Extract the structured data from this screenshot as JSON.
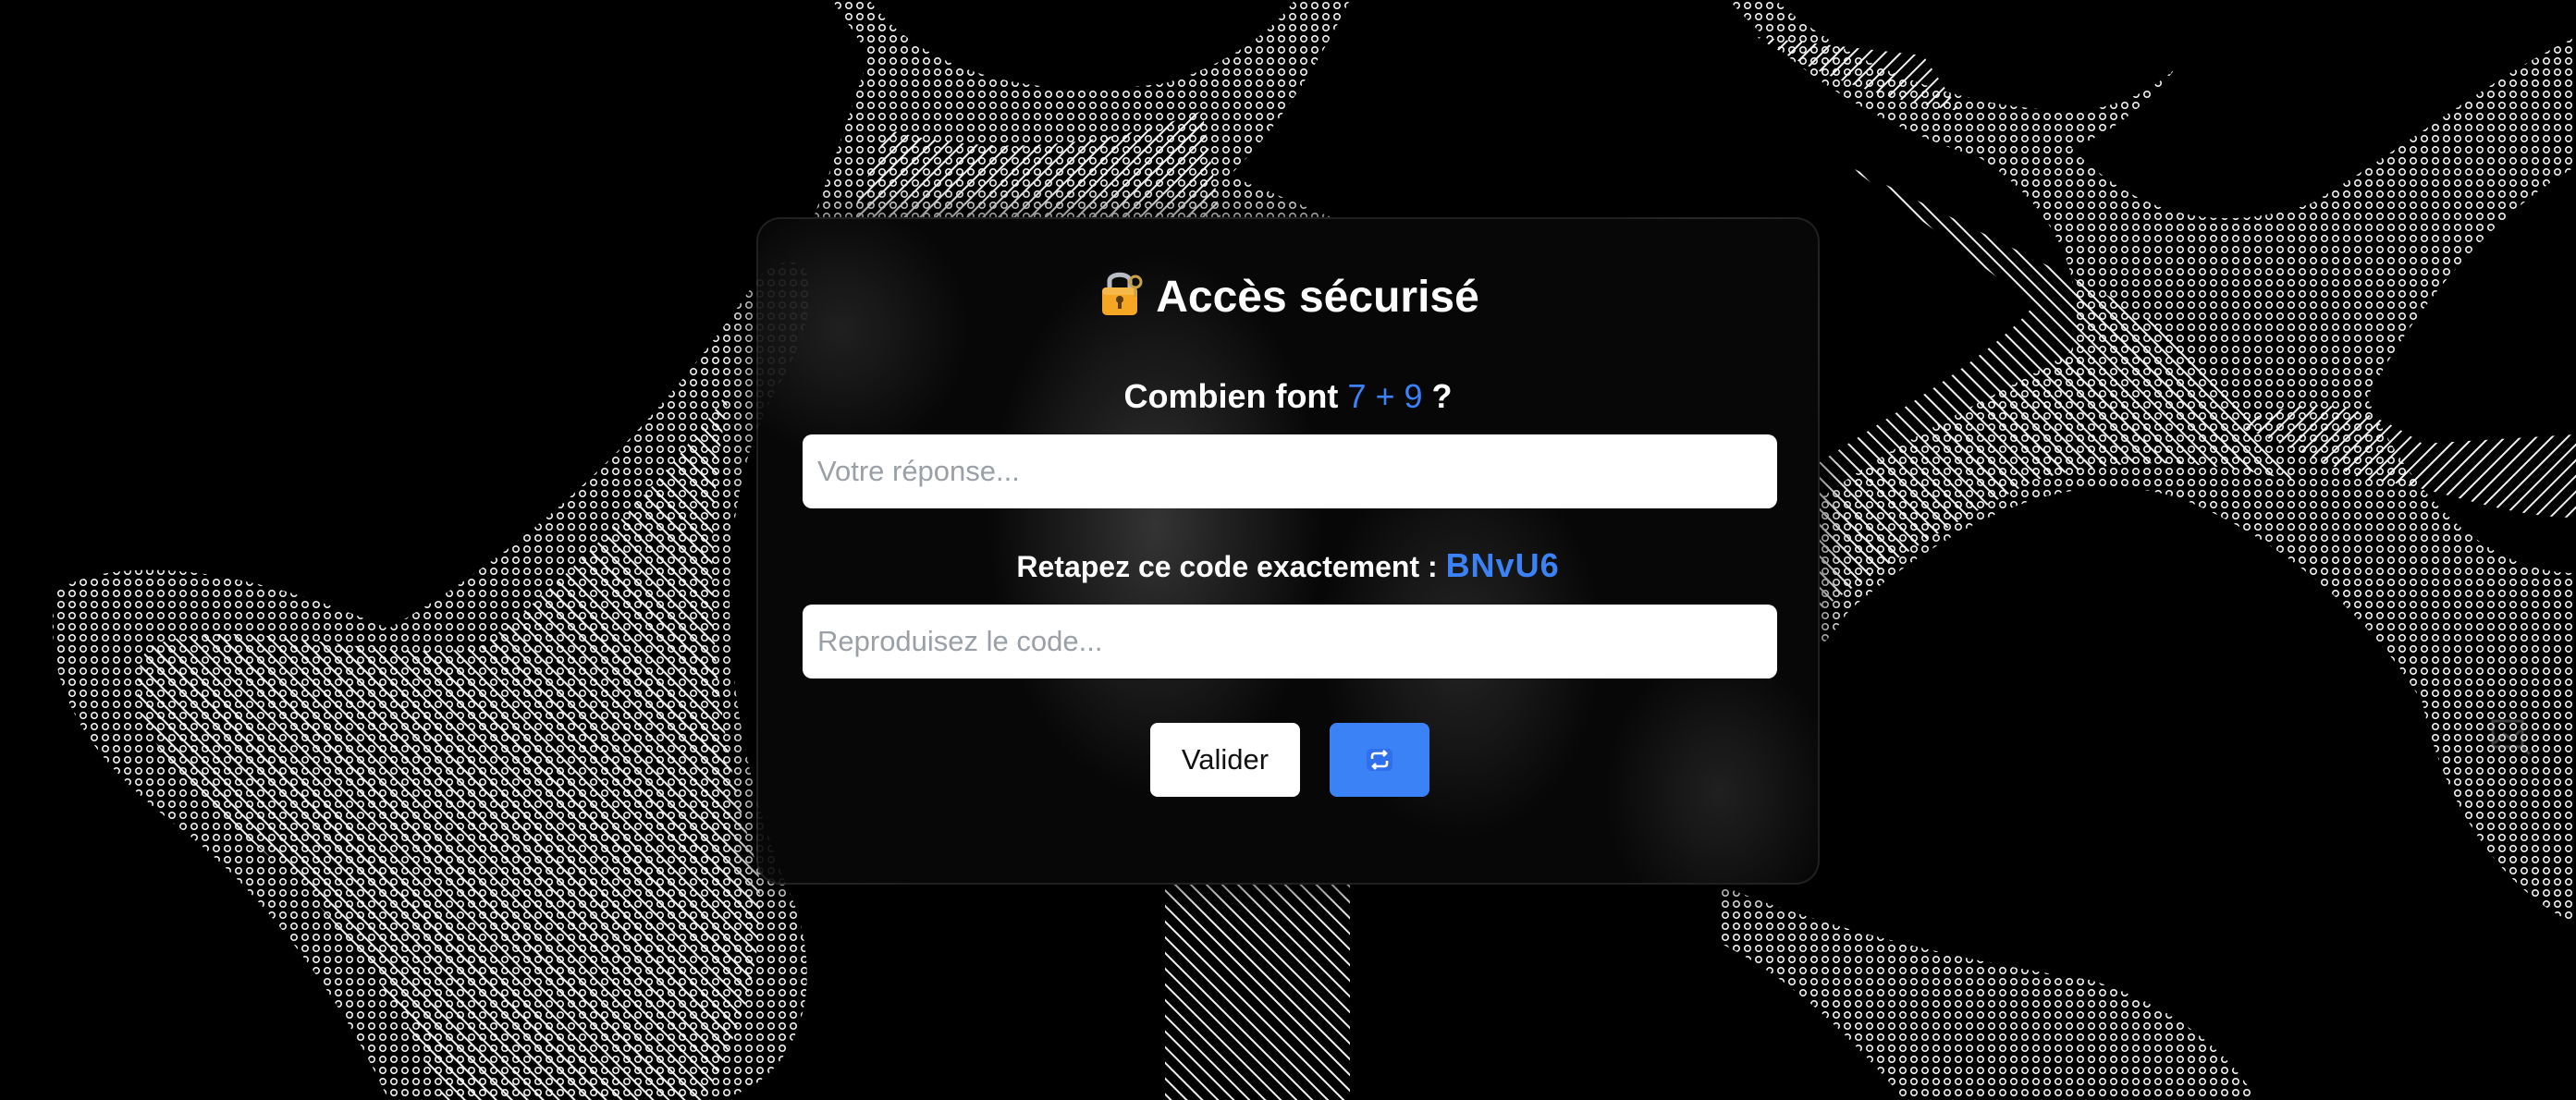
{
  "dialog": {
    "title": "Accès sécurisé",
    "title_icon": "lock-key-icon",
    "math_prompt_prefix": "Combien font",
    "math_expression": "7 + 9",
    "math_prompt_suffix": "?",
    "answer_placeholder": "Votre réponse...",
    "code_prompt": "Retapez ce code exactement :",
    "code_value": "BNvU6",
    "code_placeholder": "Reproduisez le code...",
    "validate_label": "Valider",
    "refresh_icon": "refresh-icon"
  },
  "colors": {
    "accent": "#3b82f6",
    "background": "#000000",
    "card": "#0a0a0a",
    "text": "#ffffff"
  }
}
